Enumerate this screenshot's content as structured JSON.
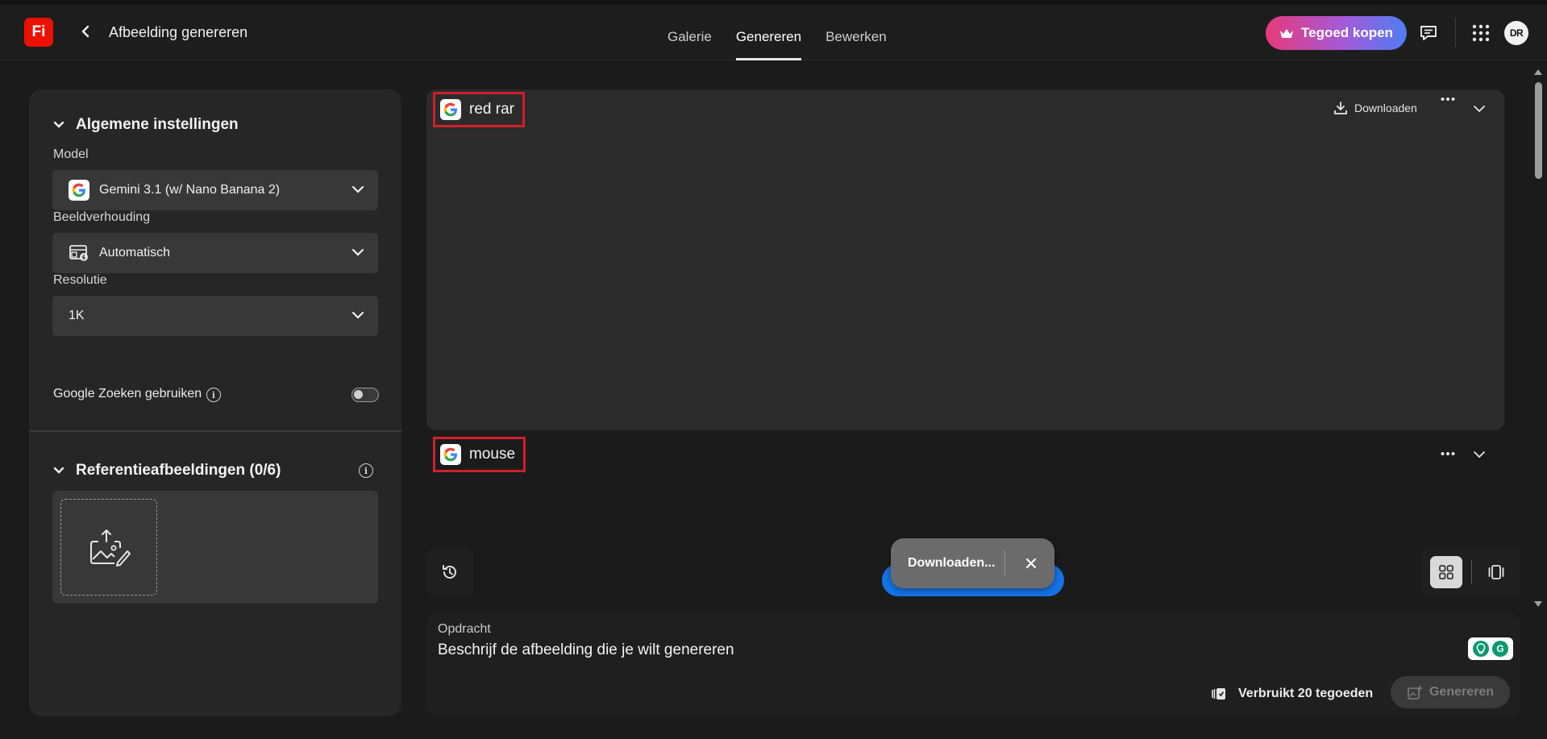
{
  "app": {
    "logo_text": "Fi",
    "title": "Afbeelding genereren"
  },
  "nav": {
    "tabs": [
      "Galerie",
      "Genereren",
      "Bewerken"
    ],
    "active_tab": "Genereren"
  },
  "header": {
    "buy_credits_label": "Tegoed kopen",
    "avatar_initials": "DR"
  },
  "left_panel": {
    "general_settings_title": "Algemene instellingen",
    "model_label": "Model",
    "model_value": "Gemini 3.1 (w/ Nano Banana 2)",
    "aspect_label": "Beeldverhouding",
    "aspect_value": "Automatisch",
    "resolution_label": "Resolutie",
    "resolution_value": "1K",
    "google_search_label": "Google Zoeken gebruiken",
    "google_search_enabled": false,
    "reference_title": "Referentieafbeeldingen (0/6)"
  },
  "results": [
    {
      "prompt": "red rar",
      "download_label": "Downloaden"
    },
    {
      "prompt": "mouse"
    }
  ],
  "toast": {
    "text": "Downloaden..."
  },
  "prompt": {
    "label": "Opdracht",
    "placeholder": "Beschrijf de afbeelding die je wilt genereren",
    "credits_text": "Verbruikt 20 tegoeden",
    "generate_label": "Genereren"
  },
  "colors": {
    "brand_red": "#eb1000",
    "highlight_red": "#d11f2a",
    "accent_blue": "#1473e6",
    "credits_gradient": [
      "#e63a78",
      "#a45ad8",
      "#4f7df2"
    ]
  }
}
